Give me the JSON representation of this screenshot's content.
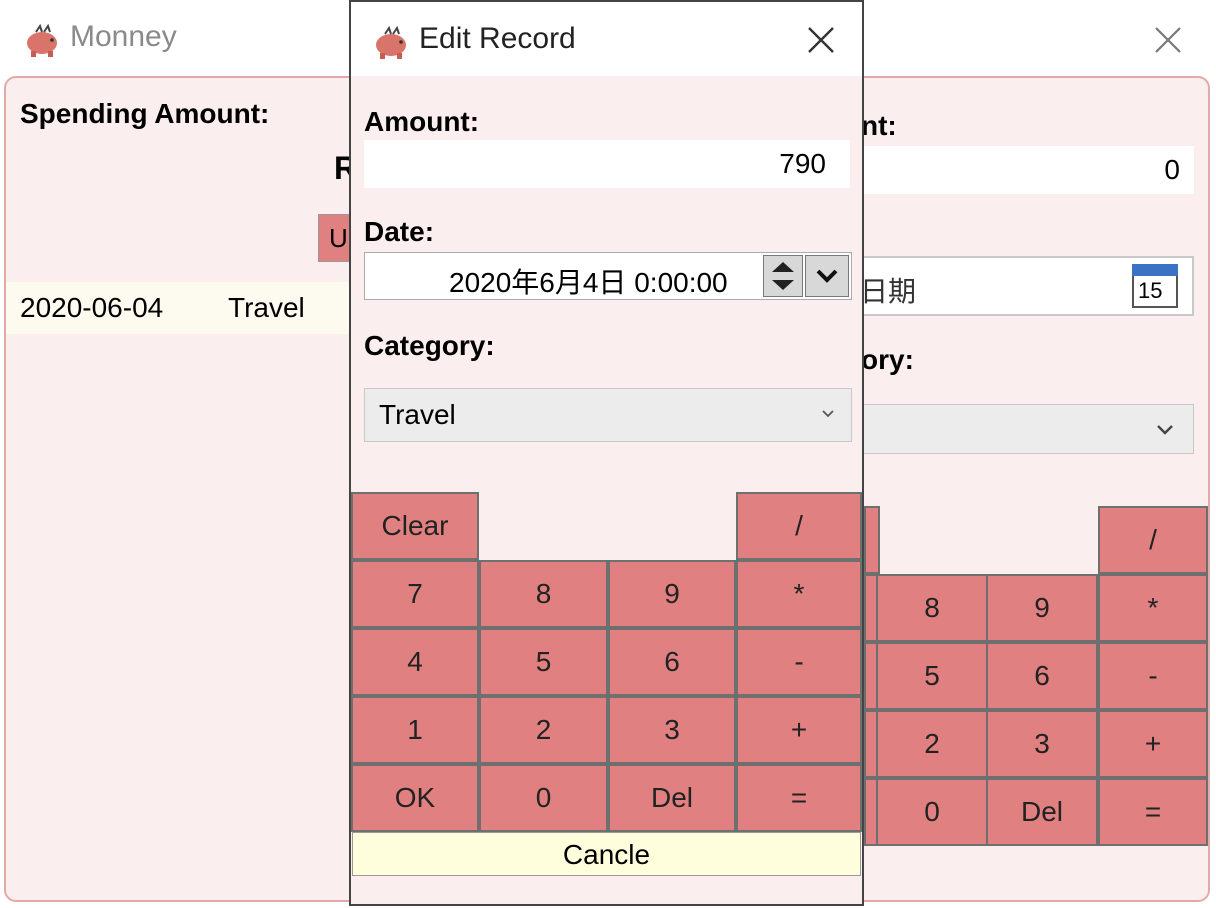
{
  "main_window": {
    "title": "Monney",
    "spending_label": "Spending Amount:",
    "header_partial": "R",
    "button_partial": "U",
    "row": {
      "date": "2020-06-04",
      "category": "Travel"
    },
    "amount_label_partial": "nt:",
    "amount_value": "0",
    "date_placeholder_partial": "日期",
    "calendar_day": "15",
    "category_label_partial": "ory:",
    "keypad": {
      "top": [
        "/"
      ],
      "rows": [
        [
          "8",
          "9",
          "*"
        ],
        [
          "5",
          "6",
          "-"
        ],
        [
          "2",
          "3",
          "+"
        ],
        [
          "0",
          "Del",
          "="
        ]
      ]
    }
  },
  "dialog": {
    "title": "Edit Record",
    "amount_label": "Amount:",
    "amount_value": "790",
    "date_label": "Date:",
    "date_value": "2020年6月4日 0:00:00",
    "category_label": "Category:",
    "category_value": "Travel",
    "keypad": {
      "clear": "Clear",
      "divide": "/",
      "rows": [
        [
          "7",
          "8",
          "9",
          "*"
        ],
        [
          "4",
          "5",
          "6",
          "-"
        ],
        [
          "1",
          "2",
          "3",
          "+"
        ],
        [
          "OK",
          "0",
          "Del",
          "="
        ]
      ]
    },
    "cancel": "Cancle"
  },
  "colors": {
    "key_fill": "#e08080",
    "key_border": "#6f6f6f",
    "body_bg": "#fbeeee",
    "list_row_bg": "#fdfaf0",
    "cancel_bg": "#fffedc"
  },
  "icons": {
    "app": "piggy-bank-icon",
    "close": "close-icon",
    "calendar": "calendar-icon",
    "dropdown": "chevron-down-icon",
    "spinner": "spinner-arrows-icon"
  }
}
